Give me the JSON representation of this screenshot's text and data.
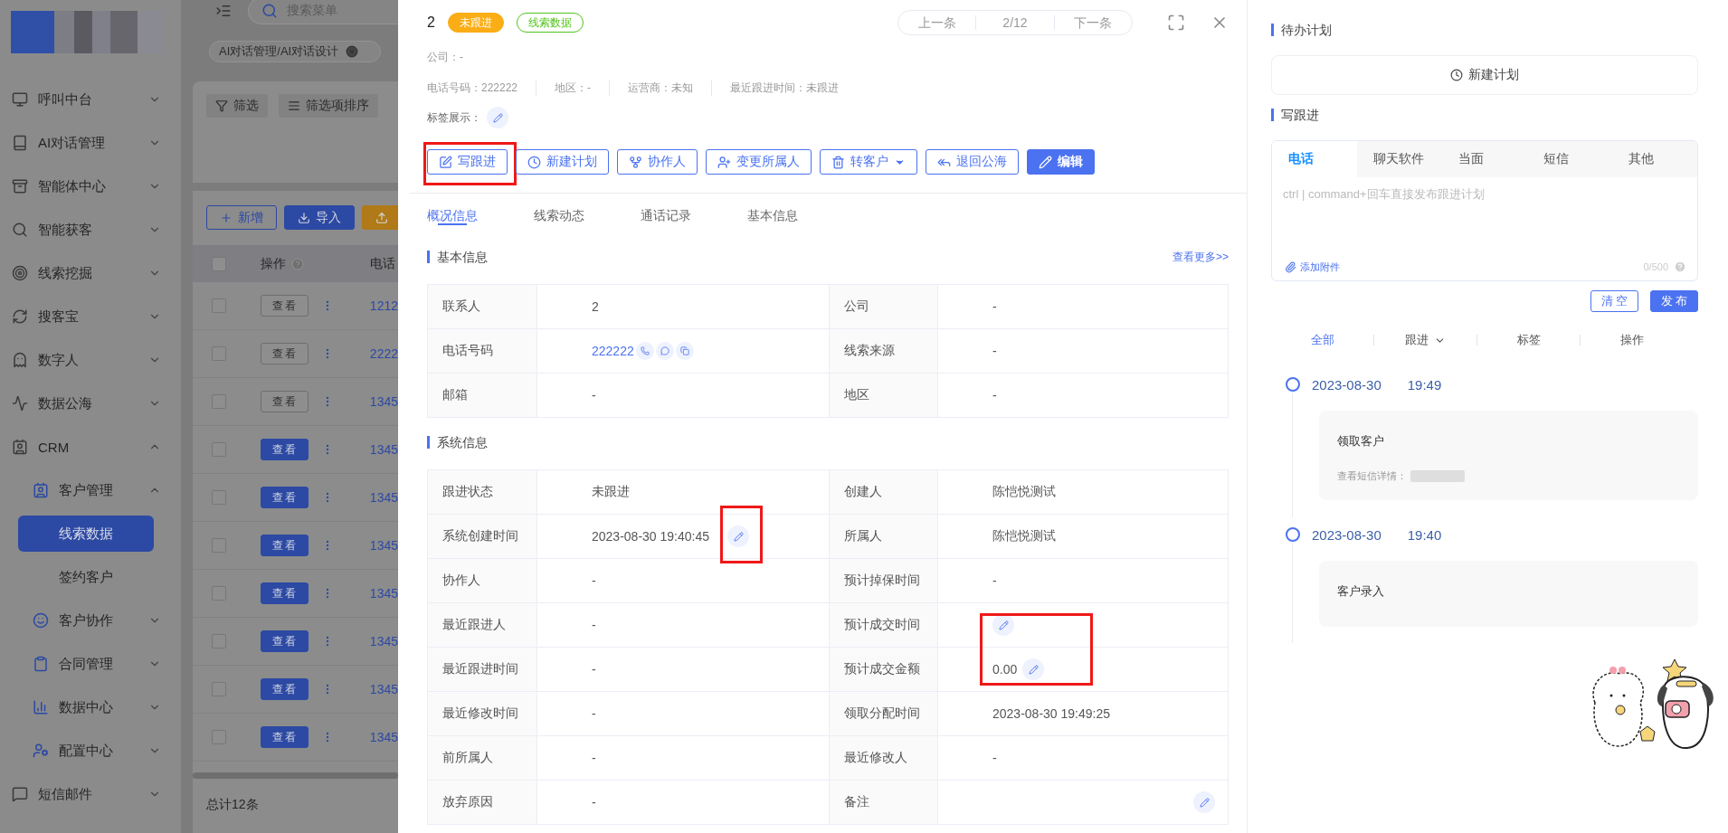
{
  "sidebar": {
    "items": [
      {
        "label": "呼叫中台",
        "expanded": false
      },
      {
        "label": "AI对话管理",
        "expanded": false
      },
      {
        "label": "智能体中心",
        "expanded": false
      },
      {
        "label": "智能获客",
        "expanded": false
      },
      {
        "label": "线索挖掘",
        "expanded": false
      },
      {
        "label": "搜客宝",
        "expanded": false
      },
      {
        "label": "数字人",
        "expanded": false
      },
      {
        "label": "数据公海",
        "expanded": false
      },
      {
        "label": "CRM",
        "expanded": true,
        "children": [
          {
            "label": "客户管理",
            "expanded": true,
            "children": [
              {
                "label": "线索数据",
                "selected": true
              },
              {
                "label": "签约客户",
                "selected": false
              }
            ]
          },
          {
            "label": "客户协作",
            "expanded": false
          },
          {
            "label": "合同管理",
            "expanded": false
          },
          {
            "label": "数据中心",
            "expanded": false
          },
          {
            "label": "配置中心",
            "expanded": false
          }
        ]
      },
      {
        "label": "短信邮件",
        "expanded": false
      }
    ]
  },
  "background": {
    "search_placeholder": "搜索菜单",
    "breadcrumb_tag": "AI对话管理/AI对话设计",
    "filters": [
      "筛选",
      "筛选项排序"
    ],
    "buttons": [
      {
        "label": "新增",
        "kind": "outline"
      },
      {
        "label": "导入",
        "kind": "primary"
      },
      {
        "kind": "warning"
      }
    ],
    "all_checked": false,
    "columns": [
      "操作",
      "电话"
    ],
    "rows": [
      {
        "checked": false,
        "action": "查看",
        "kind": "outline",
        "phone": "1212"
      },
      {
        "checked": false,
        "action": "查看",
        "kind": "outline",
        "phone": "2222"
      },
      {
        "checked": false,
        "action": "查看",
        "kind": "outline",
        "phone": "1345"
      },
      {
        "checked": false,
        "action": "查看",
        "kind": "filled",
        "phone": "1345"
      },
      {
        "checked": false,
        "action": "查看",
        "kind": "filled",
        "phone": "1345"
      },
      {
        "checked": false,
        "action": "查看",
        "kind": "filled",
        "phone": "1345"
      },
      {
        "checked": false,
        "action": "查看",
        "kind": "filled",
        "phone": "1345"
      },
      {
        "checked": false,
        "action": "查看",
        "kind": "filled",
        "phone": "1345"
      },
      {
        "checked": false,
        "action": "查看",
        "kind": "filled",
        "phone": "1345"
      },
      {
        "checked": false,
        "action": "查看",
        "kind": "filled",
        "phone": "1345"
      }
    ],
    "footer": "总计12条"
  },
  "detail": {
    "title": "2",
    "badges": [
      {
        "label": "未跟进",
        "kind": "filled"
      },
      {
        "label": "线索数据",
        "kind": "outline"
      }
    ],
    "pager": {
      "prev": "上一条",
      "position": "2/12",
      "next": "下一条"
    },
    "company": "公司：-",
    "meta": [
      "电话号码：222222",
      "地区：-",
      "运营商：未知",
      "最近跟进时间：未跟进"
    ],
    "tags_label": "标签展示：",
    "actions": [
      {
        "label": "写跟进",
        "kind": "outline",
        "highlighted": true
      },
      {
        "label": "新建计划",
        "kind": "outline",
        "highlighted": false
      },
      {
        "label": "协作人",
        "kind": "outline",
        "highlighted": false
      },
      {
        "label": "变更所属人",
        "kind": "outline",
        "highlighted": false
      },
      {
        "label": "转客户",
        "kind": "dropdown",
        "highlighted": false
      },
      {
        "label": "退回公海",
        "kind": "outline",
        "highlighted": false
      },
      {
        "label": "编辑",
        "kind": "primary",
        "highlighted": false
      }
    ],
    "tabs": [
      {
        "label": "概况信息",
        "selected": true
      },
      {
        "label": "线索动态",
        "selected": false
      },
      {
        "label": "通话记录",
        "selected": false
      },
      {
        "label": "基本信息",
        "selected": false
      }
    ],
    "sections": [
      {
        "title": "基本信息",
        "link": "查看更多>>",
        "rows": [
          [
            {
              "label": "联系人",
              "value": "2"
            },
            {
              "label": "公司",
              "value": "-"
            }
          ],
          [
            {
              "label": "电话号码",
              "value": "222222",
              "kind": "phone"
            },
            {
              "label": "线索来源",
              "value": "-"
            }
          ],
          [
            {
              "label": "邮箱",
              "value": "-"
            },
            {
              "label": "地区",
              "value": "-"
            }
          ]
        ]
      },
      {
        "title": "系统信息",
        "rows": [
          [
            {
              "label": "跟进状态",
              "value": "未跟进"
            },
            {
              "label": "创建人",
              "value": "陈恺悦测试"
            }
          ],
          [
            {
              "label": "系统创建时间",
              "value": "2023-08-30 19:40:45",
              "editable": true,
              "highlighted": true
            },
            {
              "label": "所属人",
              "value": "陈恺悦测试"
            }
          ],
          [
            {
              "label": "协作人",
              "value": "-"
            },
            {
              "label": "预计掉保时间",
              "value": "-"
            }
          ],
          [
            {
              "label": "最近跟进人",
              "value": "-"
            },
            {
              "label": "预计成交时间",
              "editable": true,
              "highlighted": true
            }
          ],
          [
            {
              "label": "最近跟进时间",
              "value": "-"
            },
            {
              "label": "预计成交金额",
              "value": "0.00",
              "editable": true,
              "highlighted": true
            }
          ],
          [
            {
              "label": "最近修改时间",
              "value": "-"
            },
            {
              "label": "领取分配时间",
              "value": "2023-08-30 19:49:25"
            }
          ],
          [
            {
              "label": "前所属人",
              "value": "-"
            },
            {
              "label": "最近修改人",
              "value": "-"
            }
          ],
          [
            {
              "label": "放弃原因",
              "value": "-"
            },
            {
              "label": "备注",
              "editable": true,
              "kind": "note"
            }
          ]
        ]
      }
    ]
  },
  "side_panel": {
    "todo": {
      "title": "待办计划",
      "new_plan": "新建计划"
    },
    "followup": {
      "title": "写跟进",
      "channels": [
        {
          "label": "电话",
          "selected": true
        },
        {
          "label": "聊天软件",
          "selected": false
        },
        {
          "label": "当面",
          "selected": false
        },
        {
          "label": "短信",
          "selected": false
        },
        {
          "label": "其他",
          "selected": false
        }
      ],
      "placeholder": "ctrl | command+回车直接发布跟进计划",
      "attach": "添加附件",
      "counter": "0/500",
      "buttons": [
        {
          "label": "清 空",
          "kind": "outline"
        },
        {
          "label": "发 布",
          "kind": "primary"
        }
      ]
    },
    "filters": [
      {
        "label": "全部",
        "selected": true
      },
      {
        "label": "跟进",
        "selected": false,
        "dropdown": true
      },
      {
        "label": "标签",
        "selected": false
      },
      {
        "label": "操作",
        "selected": false
      }
    ],
    "timeline": [
      {
        "date": "2023-08-30",
        "time": "19:49",
        "title": "领取客户",
        "detail": "查看短信详情："
      },
      {
        "date": "2023-08-30",
        "time": "19:40",
        "title": "客户录入"
      }
    ]
  }
}
